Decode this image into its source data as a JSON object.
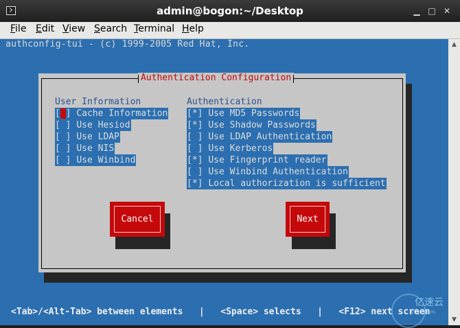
{
  "window": {
    "title": "admin@bogon:~/Desktop"
  },
  "menubar": {
    "items": [
      {
        "label": "File",
        "accel": "F",
        "rest": "ile"
      },
      {
        "label": "Edit",
        "accel": "E",
        "rest": "dit"
      },
      {
        "label": "View",
        "accel": "V",
        "rest": "iew"
      },
      {
        "label": "Search",
        "accel": "S",
        "rest": "earch"
      },
      {
        "label": "Terminal",
        "accel": "T",
        "rest": "erminal"
      },
      {
        "label": "Help",
        "accel": "H",
        "rest": "elp"
      }
    ]
  },
  "terminal": {
    "header_line": "authconfig-tui - (c) 1999-2005 Red Hat, Inc.",
    "status_line": "<Tab>/<Alt-Tab> between elements   |   <Space> selects   |   <F12> next screen"
  },
  "dialog": {
    "title": "Authentication Configuration",
    "user_info": {
      "label": "User Information",
      "options": [
        {
          "mark": " ",
          "text": "Cache Information",
          "focused": true
        },
        {
          "mark": " ",
          "text": "Use Hesiod"
        },
        {
          "mark": " ",
          "text": "Use LDAP"
        },
        {
          "mark": " ",
          "text": "Use NIS"
        },
        {
          "mark": " ",
          "text": "Use Winbind"
        }
      ]
    },
    "authentication": {
      "label": "Authentication",
      "options": [
        {
          "mark": "*",
          "text": "Use MD5 Passwords"
        },
        {
          "mark": "*",
          "text": "Use Shadow Passwords"
        },
        {
          "mark": " ",
          "text": "Use LDAP Authentication"
        },
        {
          "mark": " ",
          "text": "Use Kerberos"
        },
        {
          "mark": "*",
          "text": "Use Fingerprint reader"
        },
        {
          "mark": " ",
          "text": "Use Winbind Authentication"
        },
        {
          "mark": "*",
          "text": "Local authorization is sufficient"
        }
      ]
    },
    "buttons": {
      "cancel": "Cancel",
      "next": "Next"
    }
  },
  "watermark": {
    "text": "亿速云",
    "sub": "yisu.com"
  },
  "colors": {
    "terminal_bg": "#2c6fb0",
    "dialog_bg": "#c6c6c6",
    "accent_red": "#c5080a",
    "label_blue": "#29508f"
  }
}
